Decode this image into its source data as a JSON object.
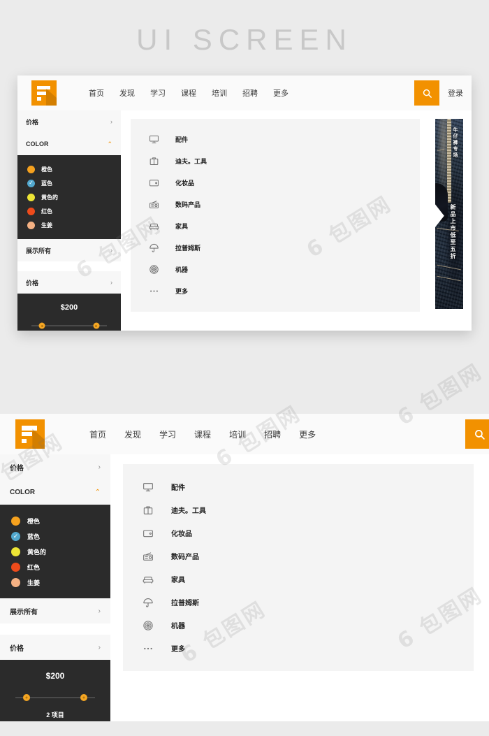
{
  "page": {
    "title": "UI SCREEN",
    "background_color": "#ebebeb",
    "watermark_text": "6 包图网"
  },
  "brand": {
    "logo_name": "f-logo",
    "accent_color": "#F29100"
  },
  "nav": {
    "items": [
      {
        "label": "首页"
      },
      {
        "label": "发现"
      },
      {
        "label": "学习"
      },
      {
        "label": "课程"
      },
      {
        "label": "培训"
      },
      {
        "label": "招聘"
      },
      {
        "label": "更多"
      }
    ],
    "search_icon": "search-icon",
    "login_label": "登录"
  },
  "sidebar": {
    "filters": [
      {
        "label": "价格",
        "state": "collapsed",
        "chevron": "›"
      },
      {
        "label": "COLOR",
        "state": "expanded",
        "chevron": "⌃"
      }
    ],
    "colors": {
      "items": [
        {
          "label": "橙色",
          "hex": "#F5A11E",
          "selected": false
        },
        {
          "label": "蓝色",
          "hex": "#52A8CE",
          "selected": true,
          "check": "✓"
        },
        {
          "label": "黄色的",
          "hex": "#EDE535",
          "selected": false
        },
        {
          "label": "红色",
          "hex": "#EE4B1B",
          "selected": false
        },
        {
          "label": "生姜",
          "hex": "#F5B183",
          "selected": false
        }
      ]
    },
    "show_all": {
      "label": "展示所有",
      "chevron": "›"
    },
    "price_filter": {
      "label": "价格",
      "chevron": "›"
    },
    "price_panel": {
      "value": "$200",
      "items_count": "2 项目",
      "slider": {
        "min_pct": 14,
        "max_pct": 86
      }
    }
  },
  "menu": {
    "items": [
      {
        "label": "配件",
        "icon": "monitor-icon"
      },
      {
        "label": "迪夫。工具",
        "icon": "briefcase-icon"
      },
      {
        "label": "化妆品",
        "icon": "wallet-icon"
      },
      {
        "label": "数码产品",
        "icon": "radio-icon"
      },
      {
        "label": "家具",
        "icon": "sofa-icon"
      },
      {
        "label": "拉普姆斯",
        "icon": "umbrella-icon"
      },
      {
        "label": "机器",
        "icon": "spiral-icon"
      },
      {
        "label": "更多",
        "icon": "ellipsis-icon"
      }
    ]
  },
  "promo": {
    "name": "jeans-banner",
    "text_top": "牛仔裤专场",
    "text_mid": "新品上市低至五折"
  }
}
